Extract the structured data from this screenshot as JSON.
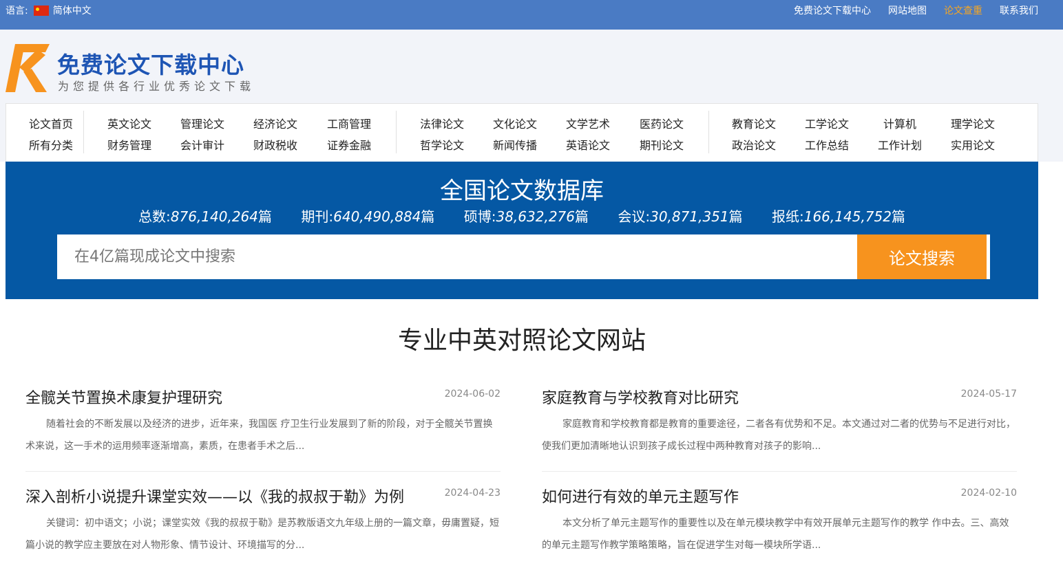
{
  "topbar": {
    "lang_label": "语言:",
    "lang_value": "简体中文",
    "links": [
      "免费论文下载中心",
      "网站地图",
      "论文查重",
      "联系我们"
    ],
    "highlight_color": "#f5a623"
  },
  "brand": {
    "title": "免费论文下载中心",
    "subtitle": "为您提供各行业优秀论文下载",
    "logo_color": "#f7931e",
    "title_color": "#1e55b4"
  },
  "nav": {
    "groups": [
      [
        [
          "论文首页",
          "所有分类"
        ]
      ],
      [
        [
          "英文论文",
          "财务管理"
        ],
        [
          "管理论文",
          "会计审计"
        ],
        [
          "经济论文",
          "财政税收"
        ],
        [
          "工商管理",
          "证券金融"
        ]
      ],
      [
        [
          "法律论文",
          "哲学论文"
        ],
        [
          "文化论文",
          "新闻传播"
        ],
        [
          "文学艺术",
          "英语论文"
        ],
        [
          "医药论文",
          "期刊论文"
        ]
      ],
      [
        [
          "教育论文",
          "政治论文"
        ],
        [
          "工学论文",
          "工作总结"
        ],
        [
          "计算机",
          "工作计划"
        ],
        [
          "理学论文",
          "实用论文"
        ]
      ]
    ]
  },
  "banner": {
    "title": "全国论文数据库",
    "stats": [
      {
        "label": "总数:",
        "value": "876,140,264",
        "unit": "篇"
      },
      {
        "label": "期刊:",
        "value": "640,490,884",
        "unit": "篇"
      },
      {
        "label": "硕博:",
        "value": "38,632,276",
        "unit": "篇"
      },
      {
        "label": "会议:",
        "value": "30,871,351",
        "unit": "篇"
      },
      {
        "label": "报纸:",
        "value": "166,145,752",
        "unit": "篇"
      }
    ],
    "search_placeholder": "在4亿篇现成论文中搜索",
    "search_button": "论文搜索",
    "bg_color": "#0558a4",
    "button_color": "#f7931e"
  },
  "section": {
    "title": "专业中英对照论文网站"
  },
  "articles": [
    {
      "title": "全髋关节置换术康复护理研究",
      "date": "2024-06-02",
      "excerpt": "随着社会的不断发展以及经济的进步，近年来，我国医 疗卫生行业发展到了新的阶段，对于全髋关节置换术来说，这一手术的运用频率逐渐增高，素质，在患者手术之后..."
    },
    {
      "title": "家庭教育与学校教育对比研究",
      "date": "2024-05-17",
      "excerpt": "家庭教育和学校教育都是教育的重要途径，二者各有优势和不足。本文通过对二者的优势与不足进行对比，使我们更加清晰地认识到孩子成长过程中两种教育对孩子的影响..."
    },
    {
      "title": "深入剖析小说提升课堂实效——以《我的叔叔于勒》为例",
      "date": "2024-04-23",
      "excerpt": "关键词：初中语文；小说；课堂实效《我的叔叔于勒》是苏教版语文九年级上册的一篇文章，毋庸置疑，短篇小说的教学应主要放在对人物形象、情节设计、环境描写的分..."
    },
    {
      "title": "如何进行有效的单元主题写作",
      "date": "2024-02-10",
      "excerpt": "本文分析了单元主题写作的重要性以及在单元模块教学中有效开展单元主题写作的教学 作中去。三、高效的单元主题写作教学策略策略，旨在促进学生对每一模块所学语..."
    }
  ]
}
